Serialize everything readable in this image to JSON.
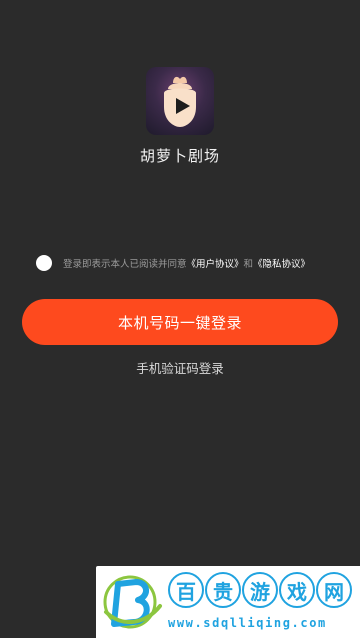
{
  "app": {
    "name": "胡萝卜剧场",
    "logo_icon": "carrot-play-icon"
  },
  "agreement": {
    "prefix": "登录即表示本人已阅读并同意",
    "user_agreement": "《用户协议》",
    "conjunction": "和",
    "privacy_agreement": "《隐私协议》",
    "checked": false
  },
  "login": {
    "one_click_label": "本机号码一键登录",
    "sms_label": "手机验证码登录"
  },
  "watermark": {
    "chars": [
      "百",
      "贵",
      "游",
      "戏",
      "网"
    ],
    "domain": "www.sdqlliqing.com",
    "logo_icon": "b-letter-logo-icon"
  },
  "colors": {
    "background": "#2b2b2b",
    "primary_button": "#fe4a1e",
    "watermark_blue": "#20a3e0",
    "watermark_green": "#8cc63f"
  }
}
